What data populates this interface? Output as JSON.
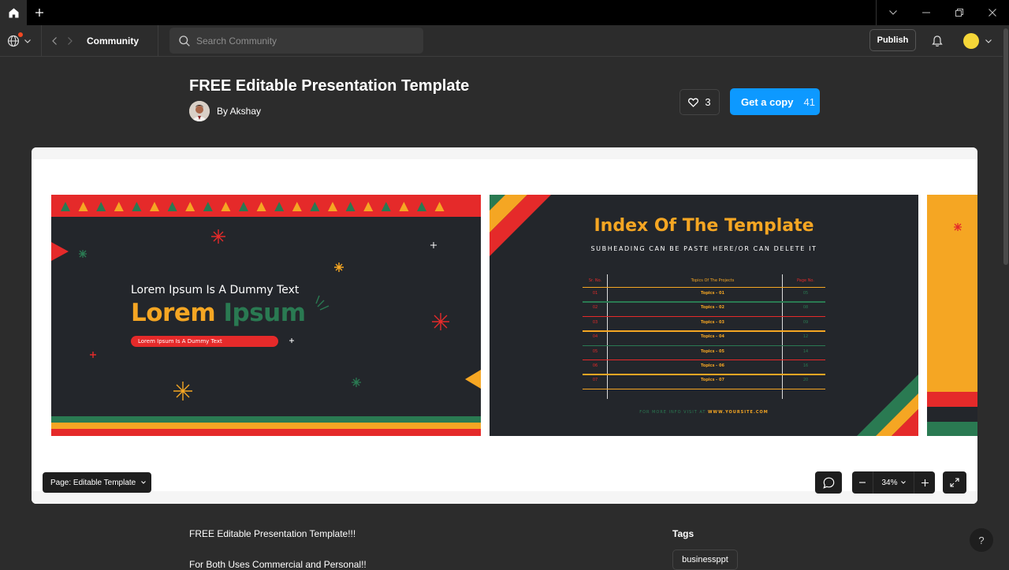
{
  "toolbar": {
    "breadcrumb": "Community",
    "search_placeholder": "Search Community",
    "publish_label": "Publish"
  },
  "file": {
    "title": "FREE Editable Presentation Template",
    "author": "By Akshay",
    "likes": "3",
    "copy_label": "Get a copy",
    "copy_count": "41"
  },
  "slides": {
    "s1": {
      "subtitle": "Lorem Ipsum Is A Dummy Text",
      "title_word1": "Lorem",
      "title_word2": "Ipsum",
      "pill_text": "Lorem Ipsum Is A Dummy Text"
    },
    "s2": {
      "title": "Index Of The Template",
      "subheading": "SUBHEADING CAN BE PASTE HERE/OR CAN DELETE IT",
      "col_headers": [
        "Sr. No.",
        "Topics Of The Projects",
        "Page No."
      ],
      "rows": [
        [
          "01",
          "Topics - 01",
          "05"
        ],
        [
          "02",
          "Topics - 02",
          "08"
        ],
        [
          "03",
          "Topics - 03",
          "09"
        ],
        [
          "04",
          "Topics - 04",
          "12"
        ],
        [
          "05",
          "Topics - 05",
          "14"
        ],
        [
          "06",
          "Topics - 06",
          "16"
        ],
        [
          "07",
          "Topics - 07",
          "20"
        ]
      ],
      "footer_prefix": "FOR MORE INFO VISIT AT",
      "footer_site": "WWW.YOURSITE.COM"
    }
  },
  "viewer": {
    "page_menu": "Page: Editable Template",
    "zoom": "34%"
  },
  "details": {
    "desc_line1": "FREE Editable Presentation Template!!!",
    "desc_line2": "For Both Uses Commercial and Personal!!",
    "tags_heading": "Tags",
    "tags": [
      "businessppt"
    ]
  },
  "colors": {
    "accent_blue": "#0d99ff",
    "slide_red": "#e52a2a",
    "slide_orange": "#f5a623",
    "slide_green": "#2a7a52"
  },
  "icons": [
    "home-icon",
    "plus-icon",
    "chevron-down-icon",
    "minimize-icon",
    "maximize-icon",
    "close-icon",
    "globe-icon",
    "chevron-left-icon",
    "chevron-right-icon",
    "search-icon",
    "bell-icon",
    "heart-icon",
    "comment-icon",
    "fullscreen-icon",
    "help-icon"
  ]
}
